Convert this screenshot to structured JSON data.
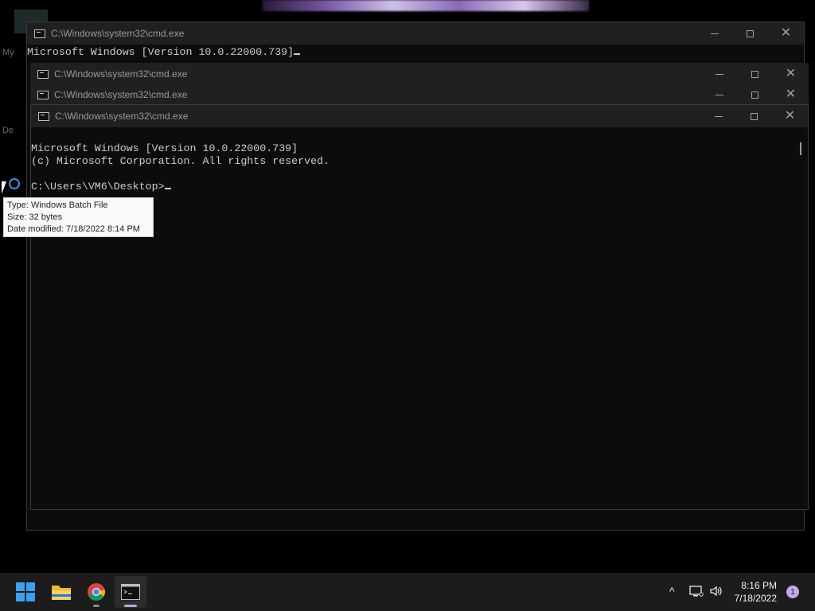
{
  "windows": {
    "back": {
      "title": "C:\\Windows\\system32\\cmd.exe",
      "line1": "Microsoft Windows [Version 10.0.22000.739]"
    },
    "stacked1": {
      "title": "C:\\Windows\\system32\\cmd.exe"
    },
    "stacked2": {
      "title": "C:\\Windows\\system32\\cmd.exe"
    },
    "front": {
      "title": "C:\\Windows\\system32\\cmd.exe",
      "lines": [
        "Microsoft Windows [Version 10.0.22000.739]",
        "(c) Microsoft Corporation. All rights reserved.",
        "",
        "C:\\Users\\VM6\\Desktop>"
      ]
    },
    "controls": {
      "minimize": "minimize",
      "maximize": "maximize",
      "close": "✕"
    }
  },
  "desktop": {
    "label_fragment1": "My",
    "label_fragment2": "De"
  },
  "tooltip": {
    "type_line": "Type: Windows Batch File",
    "size_line": "Size: 32 bytes",
    "date_line": "Date modified: 7/18/2022 8:14 PM"
  },
  "taskbar": {
    "apps": [
      {
        "name": "start",
        "icon": "windows-logo-icon"
      },
      {
        "name": "file-explorer",
        "icon": "folder-icon"
      },
      {
        "name": "chrome",
        "icon": "chrome-icon"
      },
      {
        "name": "command-prompt",
        "icon": "terminal-icon"
      }
    ],
    "tray": {
      "chevron": "^",
      "time": "8:16 PM",
      "date": "7/18/2022",
      "notification_count": "1"
    }
  },
  "colors": {
    "console_bg": "#0c0c0c",
    "titlebar_bg": "#202020",
    "taskbar_bg": "#1c1c1c",
    "accent": "#c7a3e6"
  }
}
